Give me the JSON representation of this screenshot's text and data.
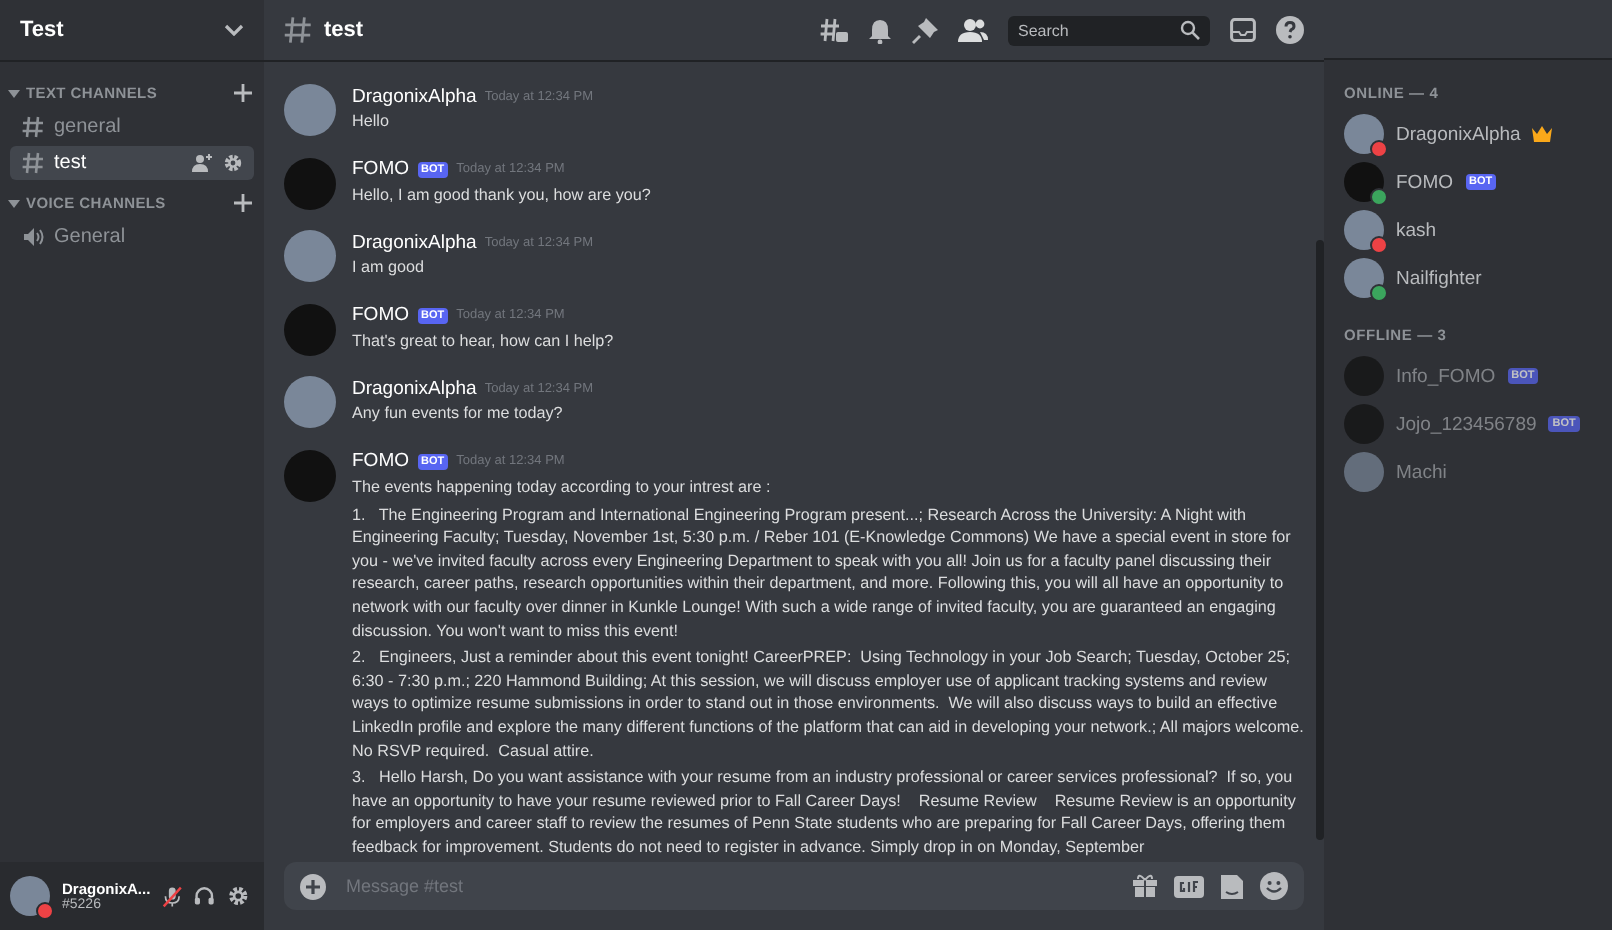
{
  "server": {
    "name": "Test"
  },
  "categories": [
    {
      "label": "TEXT CHANNELS",
      "expanded": true,
      "channels": [
        {
          "kind": "text",
          "name": "general",
          "selected": false
        },
        {
          "kind": "text",
          "name": "test",
          "selected": true
        }
      ]
    },
    {
      "label": "VOICE CHANNELS",
      "expanded": true,
      "channels": [
        {
          "kind": "voice",
          "name": "General",
          "selected": false
        }
      ]
    }
  ],
  "user_panel": {
    "name": "DragonixA...",
    "tag": "#5226",
    "color": "#ed4245",
    "mic_muted": true
  },
  "header": {
    "channel": "test",
    "search_placeholder": "Search"
  },
  "messages": [
    {
      "author": "DragonixAlpha",
      "bot": false,
      "time": "Today at 12:34 PM",
      "paragraphs": [
        "Hello"
      ]
    },
    {
      "author": "FOMO",
      "bot": true,
      "bot_label": "BOT",
      "time": "Today at 12:34 PM",
      "paragraphs": [
        "Hello, I am good thank you, how are you?"
      ]
    },
    {
      "author": "DragonixAlpha",
      "bot": false,
      "time": "Today at 12:34 PM",
      "paragraphs": [
        "I am good"
      ]
    },
    {
      "author": "FOMO",
      "bot": true,
      "bot_label": "BOT",
      "time": "Today at 12:34 PM",
      "paragraphs": [
        "That's great to hear, how can I help?"
      ]
    },
    {
      "author": "DragonixAlpha",
      "bot": false,
      "time": "Today at 12:34 PM",
      "paragraphs": [
        "Any fun events for me today?"
      ]
    },
    {
      "author": "FOMO",
      "bot": true,
      "bot_label": "BOT",
      "time": "Today at 12:34 PM",
      "paragraphs": [
        "The events happening today according to your intrest are :",
        "1.   The Engineering Program and International Engineering Program present...; Research Across the University: A Night with Engineering Faculty; Tuesday, November 1st, 5:30 p.m. / Reber 101 (E-Knowledge Commons) We have a special event in store for you - we've invited faculty across every Engineering Department to speak with you all! Join us for a faculty panel discussing their research, career paths, research opportunities within their department, and more. Following this, you will all have an opportunity to network with our faculty over dinner in Kunkle Lounge! With such a wide range of invited faculty, you are guaranteed an engaging discussion. You won't want to miss this event!",
        "2.   Engineers, Just a reminder about this event tonight! CareerPREP:  Using Technology in your Job Search; Tuesday, October 25; 6:30 - 7:30 p.m.; 220 Hammond Building; At this session, we will discuss employer use of applicant tracking systems and review ways to optimize resume submissions in order to stand out in those environments.  We will also discuss ways to build an effective LinkedIn profile and explore the many different functions of the platform that can aid in developing your network.; All majors welcome.  No RSVP required.  Casual attire.",
        "3.   Hello Harsh, Do you want assistance with your resume from an industry professional or career services professional?  If so, you have an opportunity to have your resume reviewed prior to Fall Career Days!    Resume Review    Resume Review is an opportunity for employers and career staff to review the resumes of Penn State students who are preparing for Fall Career Days, offering them feedback for improvement. Students do not need to register in advance. Simply drop in on Monday, September"
      ]
    }
  ],
  "composer": {
    "placeholder": "Message #test"
  },
  "member_groups": [
    {
      "label": "ONLINE — 4",
      "online": true,
      "members": [
        {
          "name": "DragonixAlpha",
          "bot": false,
          "owner": true,
          "color": "#ed4245"
        },
        {
          "name": "FOMO",
          "bot": true,
          "bot_label": "BOT",
          "owner": false,
          "color": "#3ba55d"
        },
        {
          "name": "kash",
          "bot": false,
          "owner": false,
          "color": "#ed4245"
        },
        {
          "name": "Nailfighter",
          "bot": false,
          "owner": false,
          "color": "#3ba55d"
        }
      ]
    },
    {
      "label": "OFFLINE — 3",
      "online": false,
      "members": [
        {
          "name": "Info_FOMO",
          "bot": true,
          "bot_label": "BOT",
          "owner": false
        },
        {
          "name": "Jojo_123456789",
          "bot": true,
          "bot_label": "BOT",
          "owner": false
        },
        {
          "name": "Machi",
          "bot": false,
          "owner": false
        }
      ]
    }
  ]
}
